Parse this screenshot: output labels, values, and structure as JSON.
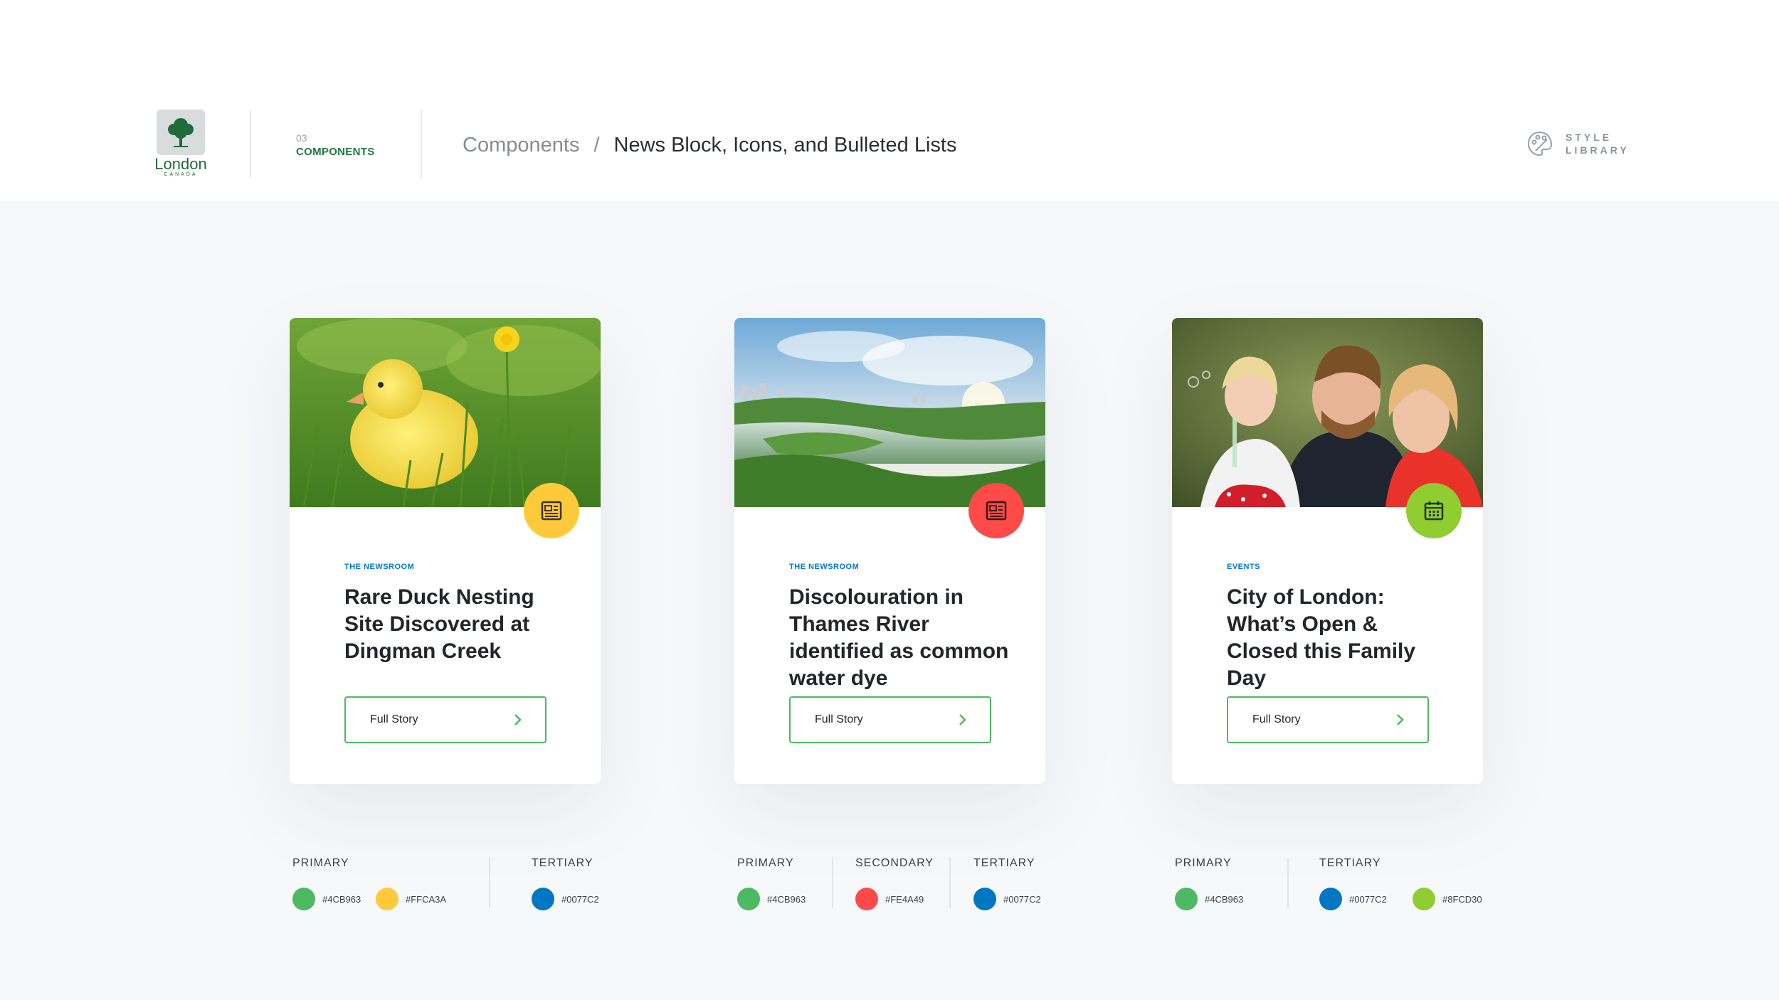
{
  "header": {
    "logo_word": "London",
    "logo_sub": "CANADA",
    "section_number": "03",
    "section_name": "COMPONENTS",
    "breadcrumb_parent": "Components",
    "breadcrumb_separator": "/",
    "breadcrumb_current": "News Block, Icons, and Bulleted Lists",
    "style_library_line1": "STYLE",
    "style_library_line2": "LIBRARY"
  },
  "cards": [
    {
      "tag": "THE NEWSROOM",
      "title": "Rare Duck Nesting Site Discovered at Dingman Creek",
      "button": "Full Story",
      "icon": "newspaper-icon",
      "icon_color": "#FFCA3A",
      "image": "duckling-in-grass"
    },
    {
      "tag": "THE NEWSROOM",
      "title": "Discolouration in Thames River identified as common water dye",
      "button": "Full Story",
      "icon": "newspaper-icon",
      "icon_color": "#FE4A49",
      "image": "river-landscape"
    },
    {
      "tag": "EVENTS",
      "title": "City of London: What’s Open & Closed this Family Day",
      "button": "Full Story",
      "icon": "calendar-icon",
      "icon_color": "#8FCD30",
      "image": "family-blowing-bubbles"
    }
  ],
  "palettes": [
    {
      "groups": [
        {
          "label": "PRIMARY",
          "colors": [
            {
              "hex": "#4CB963"
            },
            {
              "hex": "#FFCA3A"
            }
          ]
        },
        {
          "label": "TERTIARY",
          "colors": [
            {
              "hex": "#0077C2"
            }
          ]
        }
      ]
    },
    {
      "groups": [
        {
          "label": "PRIMARY",
          "colors": [
            {
              "hex": "#4CB963"
            }
          ]
        },
        {
          "label": "SECONDARY",
          "colors": [
            {
              "hex": "#FE4A49"
            }
          ]
        },
        {
          "label": "TERTIARY",
          "colors": [
            {
              "hex": "#0077C2"
            }
          ]
        }
      ]
    },
    {
      "groups": [
        {
          "label": "PRIMARY",
          "colors": [
            {
              "hex": "#4CB963"
            }
          ]
        },
        {
          "label": "TERTIARY",
          "colors": [
            {
              "hex": "#0077C2"
            },
            {
              "hex": "#8FCD30"
            }
          ]
        }
      ]
    }
  ],
  "colors": {
    "brand_green": "#1E7A3C",
    "button_border": "#4CB963",
    "tag_blue": "#0077C2"
  }
}
